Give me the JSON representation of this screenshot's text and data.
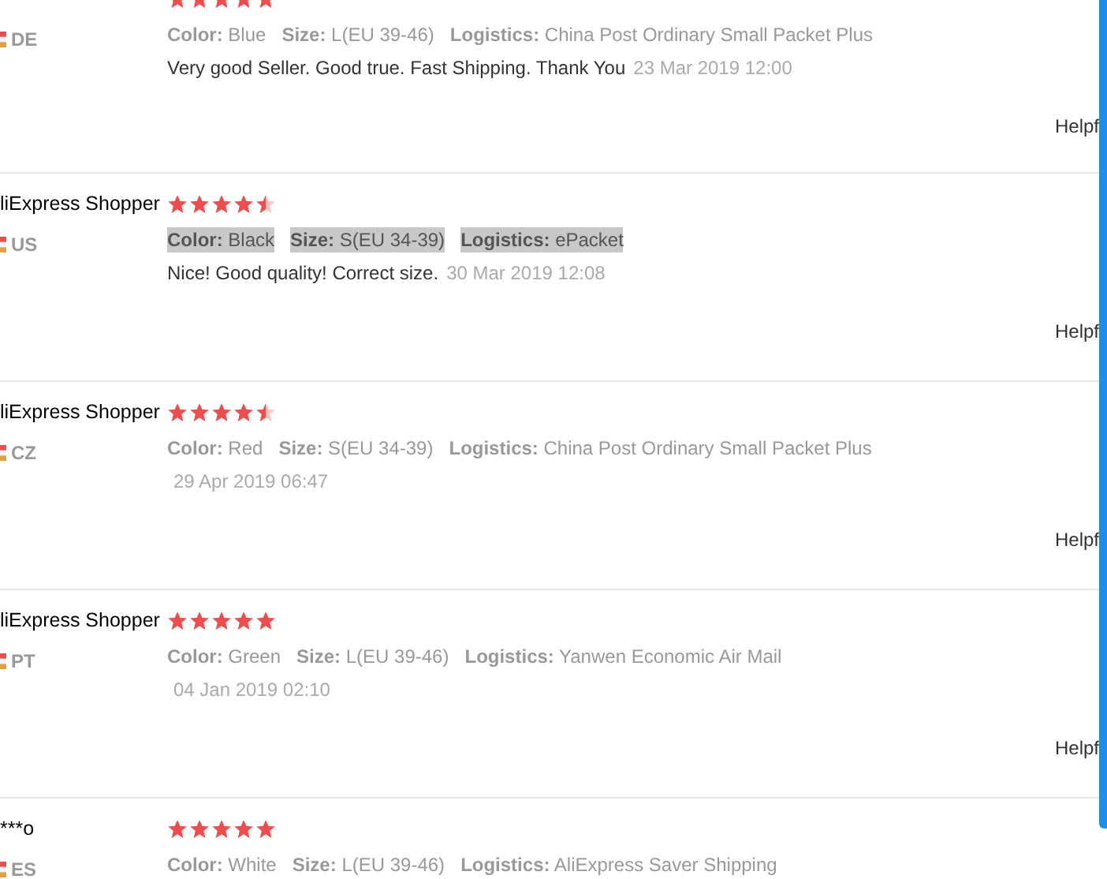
{
  "reviews": [
    {
      "country": "DE",
      "stars": 5,
      "attributes": [
        {
          "label": "Color:",
          "value": "Blue"
        },
        {
          "label": "Size:",
          "value": "L(EU 39-46)"
        },
        {
          "label": "Logistics:",
          "value": "China Post Ordinary Small Packet Plus"
        }
      ],
      "highlighted": false,
      "comment": "Very good Seller. Good true. Fast Shipping. Thank You",
      "date": "23 Mar 2019 12:00",
      "helpful": "Helpf"
    },
    {
      "name": "liExpress Shopper",
      "country": "US",
      "stars": 4.5,
      "attributes": [
        {
          "label": "Color:",
          "value": "Black"
        },
        {
          "label": "Size:",
          "value": "S(EU 34-39)"
        },
        {
          "label": "Logistics:",
          "value": "ePacket"
        }
      ],
      "highlighted": true,
      "comment": "Nice! Good quality! Correct size.",
      "date": "30 Mar 2019 12:08",
      "helpful": "Helpf"
    },
    {
      "name": "liExpress Shopper",
      "country": "CZ",
      "stars": 4.5,
      "attributes": [
        {
          "label": "Color:",
          "value": "Red"
        },
        {
          "label": "Size:",
          "value": "S(EU 34-39)"
        },
        {
          "label": "Logistics:",
          "value": "China Post Ordinary Small Packet Plus"
        }
      ],
      "highlighted": false,
      "date": "29 Apr 2019 06:47",
      "helpful": "Helpf"
    },
    {
      "name": "liExpress Shopper",
      "country": "PT",
      "stars": 5,
      "attributes": [
        {
          "label": "Color:",
          "value": "Green"
        },
        {
          "label": "Size:",
          "value": "L(EU 39-46)"
        },
        {
          "label": "Logistics:",
          "value": "Yanwen Economic Air Mail"
        }
      ],
      "highlighted": false,
      "date": "04 Jan 2019 02:10",
      "helpful": "Helpf"
    },
    {
      "name": "***o",
      "country": "ES",
      "stars": 5,
      "attributes": [
        {
          "label": "Color:",
          "value": "White"
        },
        {
          "label": "Size:",
          "value": "L(EU 39-46)"
        },
        {
          "label": "Logistics:",
          "value": "AliExpress Saver Shipping"
        }
      ],
      "highlighted": false
    }
  ]
}
